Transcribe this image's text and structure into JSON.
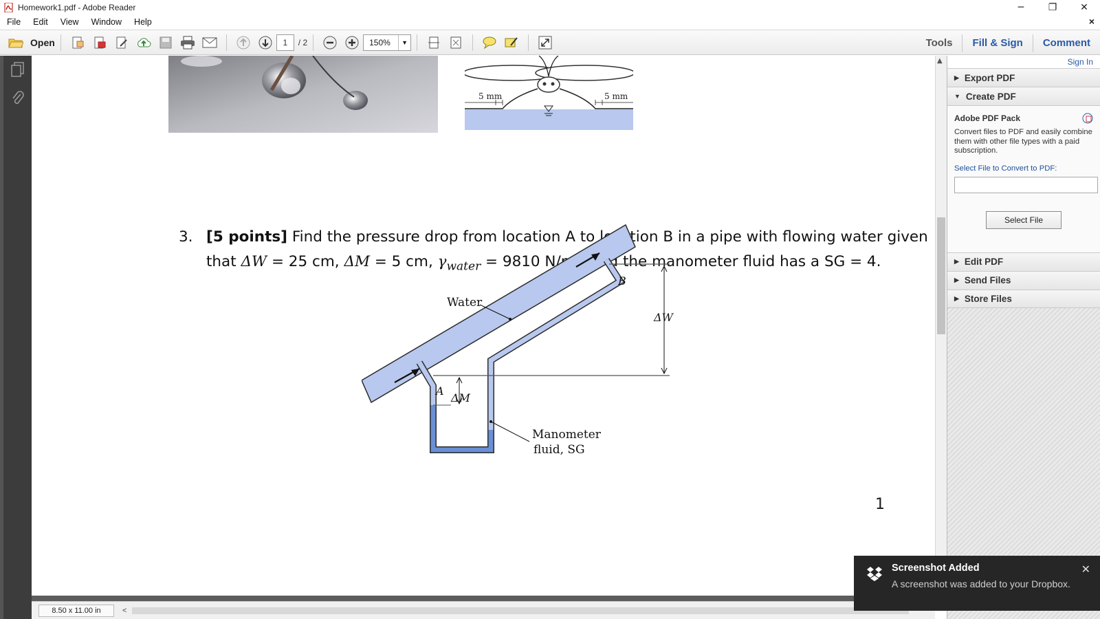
{
  "window": {
    "title": "Homework1.pdf - Adobe Reader",
    "minimize": "─",
    "restore": "❐",
    "close": "✕"
  },
  "menu": {
    "items": [
      "File",
      "Edit",
      "View",
      "Window",
      "Help"
    ],
    "doc_close": "×"
  },
  "toolbar": {
    "open_label": "Open",
    "page_current": "1",
    "page_total": "/ 2",
    "zoom": "150%",
    "tools_label": "Tools",
    "fill_sign_label": "Fill & Sign",
    "comment_label": "Comment"
  },
  "document": {
    "figure_top": {
      "dim_left": "5 mm",
      "dim_right": "5 mm"
    },
    "question": {
      "number": "3.",
      "points": "[5 points]",
      "text1": " Find the pressure drop from location A to location B in a pipe with flowing water given",
      "text2a": "that ",
      "dW": "ΔW",
      "text2b": " = 25 cm, ",
      "dM": "ΔM",
      "text2c": " = 5 cm, ",
      "gamma": "γ",
      "gamma_sub": "water",
      "text2d": " = 9810 N/m",
      "sup": "3",
      "text2e": ", and the manometer fluid has a SG = 4."
    },
    "figure": {
      "water_label": "Water",
      "point_a": "A",
      "point_b": "B",
      "delta_m": "ΔM",
      "delta_w": "ΔW",
      "manometer_line1": "Manometer",
      "manometer_line2": "fluid, SG"
    },
    "page_number": "1"
  },
  "status": {
    "page_size": "8.50 x 11.00 in",
    "scroll_left": "<"
  },
  "right_pane": {
    "sign_in": "Sign In",
    "export_pdf": "Export PDF",
    "create_pdf": "Create PDF",
    "pack_title": "Adobe PDF Pack",
    "pack_desc": "Convert files to PDF and easily combine them with other file types with a paid subscription.",
    "select_label": "Select File to Convert to PDF:",
    "select_button": "Select File",
    "edit_pdf": "Edit PDF",
    "send_files": "Send Files",
    "store_files": "Store Files"
  },
  "toast": {
    "title": "Screenshot Added",
    "message": "A screenshot was added to your Dropbox.",
    "close": "✕"
  },
  "colors": {
    "pipe_fill": "#b8c8ee",
    "manometer_fluid": "#6a8fd6",
    "link_blue": "#2a5aa6",
    "toast_bg": "#262626"
  }
}
